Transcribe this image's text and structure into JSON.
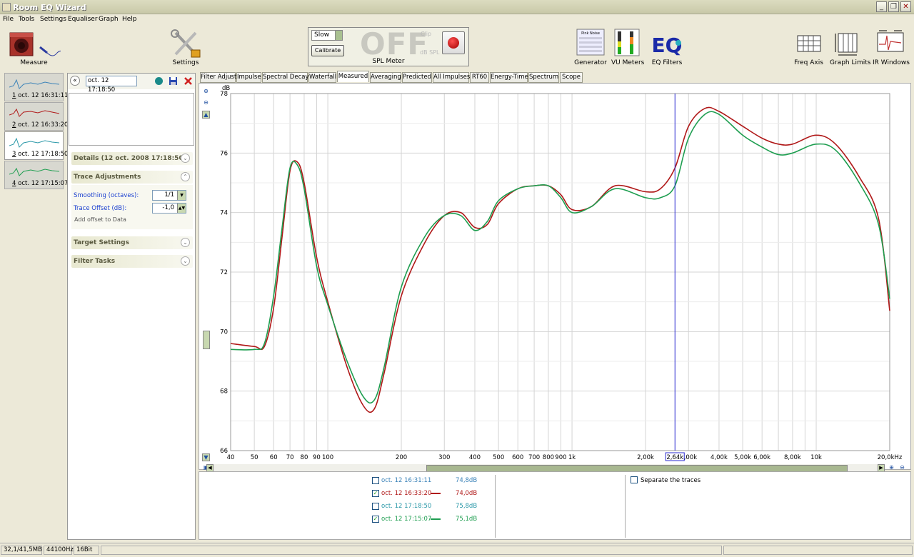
{
  "window": {
    "title": "Room EQ Wizard"
  },
  "menu": [
    "File",
    "Tools",
    "Settings",
    "Equaliser",
    "Graph",
    "Help"
  ],
  "toolbar": {
    "measure": "Measure",
    "settings": "Settings",
    "generator": "Generator",
    "vu_meters": "VU Meters",
    "eq_filters": "EQ Filters",
    "freq_axis": "Freq Axis",
    "graph_limits": "Graph Limits",
    "ir_windows": "IR Windows",
    "generator_panel_title": "Pink Noise"
  },
  "spl_meter": {
    "mode": "Slow",
    "calibrate": "Calibrate",
    "display": "OFF",
    "clip": "Clip",
    "unit": "dB SPL",
    "label": "SPL Meter"
  },
  "measurements": [
    {
      "index": "1",
      "label": "oct. 12 16:31:11",
      "color": "#3a82b8"
    },
    {
      "index": "2",
      "label": "oct. 12 16:33:20",
      "color": "#b01818"
    },
    {
      "index": "3",
      "label": "oct. 12 17:18:50",
      "color": "#2a98a8"
    },
    {
      "index": "4",
      "label": "oct. 12 17:15:07",
      "color": "#1e9e50"
    }
  ],
  "panel": {
    "name_value": "oct. 12 17:18:50",
    "details_title": "Details  (12 oct. 2008 17:18:50)",
    "trace_adjustments": "Trace Adjustments",
    "smoothing_label": "Smoothing (octaves):",
    "smoothing_value": "1/1",
    "offset_label": "Trace Offset (dB):",
    "offset_value": "-1,0",
    "add_offset": "Add offset to Data",
    "target_settings": "Target Settings",
    "filter_tasks": "Filter Tasks"
  },
  "tabs": [
    "Filter Adjust",
    "Impulse",
    "Spectral Decay",
    "Waterfall",
    "Measured",
    "Averaging",
    "Predicted",
    "All Impulses",
    "RT60",
    "Energy-Time",
    "Spectrum",
    "Scope"
  ],
  "active_tab": "Measured",
  "chart_data": {
    "type": "line",
    "ylabel": "dB",
    "ylim": [
      66,
      78
    ],
    "y_ticks": [
      "66",
      "68",
      "70",
      "72",
      "74",
      "76",
      "78"
    ],
    "xlim": [
      40,
      20000
    ],
    "x_scale": "log",
    "x_ticks": [
      {
        "v": 40,
        "t": "40"
      },
      {
        "v": 50,
        "t": "50"
      },
      {
        "v": 60,
        "t": "60"
      },
      {
        "v": 70,
        "t": "70"
      },
      {
        "v": 80,
        "t": "80"
      },
      {
        "v": 90,
        "t": "90"
      },
      {
        "v": 100,
        "t": "100"
      },
      {
        "v": 200,
        "t": "200"
      },
      {
        "v": 300,
        "t": "300"
      },
      {
        "v": 400,
        "t": "400"
      },
      {
        "v": 500,
        "t": "500"
      },
      {
        "v": 600,
        "t": "600"
      },
      {
        "v": 700,
        "t": "700"
      },
      {
        "v": 800,
        "t": "800"
      },
      {
        "v": 900,
        "t": "900"
      },
      {
        "v": 1000,
        "t": "1k"
      },
      {
        "v": 2000,
        "t": "2,00k"
      },
      {
        "v": 3000,
        "t": "3,00k"
      },
      {
        "v": 4000,
        "t": "4,00k"
      },
      {
        "v": 5000,
        "t": "5,00k"
      },
      {
        "v": 6000,
        "t": "6,00k"
      },
      {
        "v": 8000,
        "t": "8,00k"
      },
      {
        "v": 10000,
        "t": "10k"
      },
      {
        "v": 20000,
        "t": "20,0kHz"
      }
    ],
    "cursor": {
      "freq": 2640,
      "label": "2,64k"
    },
    "series": [
      {
        "color": "#b01818",
        "x": [
          40,
          50,
          55,
          60,
          65,
          70,
          75,
          80,
          90,
          100,
          120,
          140,
          155,
          170,
          200,
          250,
          300,
          350,
          400,
          450,
          500,
          600,
          700,
          800,
          900,
          1000,
          1200,
          1500,
          2000,
          2300,
          2640,
          3000,
          3500,
          4000,
          5000,
          6000,
          7000,
          8000,
          10000,
          12000,
          15000,
          18000,
          20000
        ],
        "y": [
          69.6,
          69.5,
          69.5,
          70.8,
          73.2,
          75.4,
          75.7,
          75.0,
          72.5,
          71.0,
          68.8,
          67.5,
          67.4,
          68.6,
          71.2,
          73.0,
          73.9,
          74.0,
          73.5,
          73.6,
          74.3,
          74.8,
          74.9,
          74.9,
          74.6,
          74.1,
          74.2,
          74.9,
          74.7,
          74.8,
          75.5,
          76.9,
          77.5,
          77.4,
          76.9,
          76.5,
          76.3,
          76.3,
          76.6,
          76.3,
          75.2,
          73.8,
          70.7
        ]
      },
      {
        "color": "#1e9e50",
        "x": [
          40,
          50,
          55,
          60,
          65,
          70,
          75,
          80,
          90,
          100,
          120,
          140,
          155,
          170,
          200,
          250,
          300,
          350,
          400,
          450,
          500,
          600,
          700,
          800,
          900,
          1000,
          1200,
          1500,
          2000,
          2300,
          2640,
          3000,
          3500,
          4000,
          5000,
          6000,
          7000,
          8000,
          10000,
          12000,
          15000,
          18000,
          20000
        ],
        "y": [
          69.4,
          69.4,
          69.6,
          71.2,
          73.5,
          75.5,
          75.6,
          74.8,
          72.2,
          70.9,
          69.0,
          67.8,
          67.7,
          68.8,
          71.5,
          73.2,
          73.9,
          73.9,
          73.4,
          73.7,
          74.4,
          74.8,
          74.9,
          74.9,
          74.5,
          74.0,
          74.2,
          74.8,
          74.5,
          74.5,
          74.9,
          76.5,
          77.3,
          77.3,
          76.6,
          76.2,
          75.95,
          76.0,
          76.3,
          76.1,
          75.0,
          73.6,
          71.1
        ]
      }
    ]
  },
  "legend": {
    "items": [
      {
        "name": "oct. 12 16:31:11",
        "value": "74,8dB",
        "checked": false,
        "color": "#3a82b8",
        "show_line": false
      },
      {
        "name": "oct. 12 16:33:20",
        "value": "74,0dB",
        "checked": true,
        "color": "#b01818",
        "show_line": true
      },
      {
        "name": "oct. 12 17:18:50",
        "value": "75,8dB",
        "checked": false,
        "color": "#2a98a8",
        "show_line": false
      },
      {
        "name": "oct. 12 17:15:07",
        "value": "75,1dB",
        "checked": true,
        "color": "#1e9e50",
        "show_line": true
      }
    ],
    "separate_traces": "Separate the traces"
  },
  "status": {
    "memory": "32,1/41,5MB",
    "sample_rate": "44100Hz",
    "bits": "16Bit"
  }
}
